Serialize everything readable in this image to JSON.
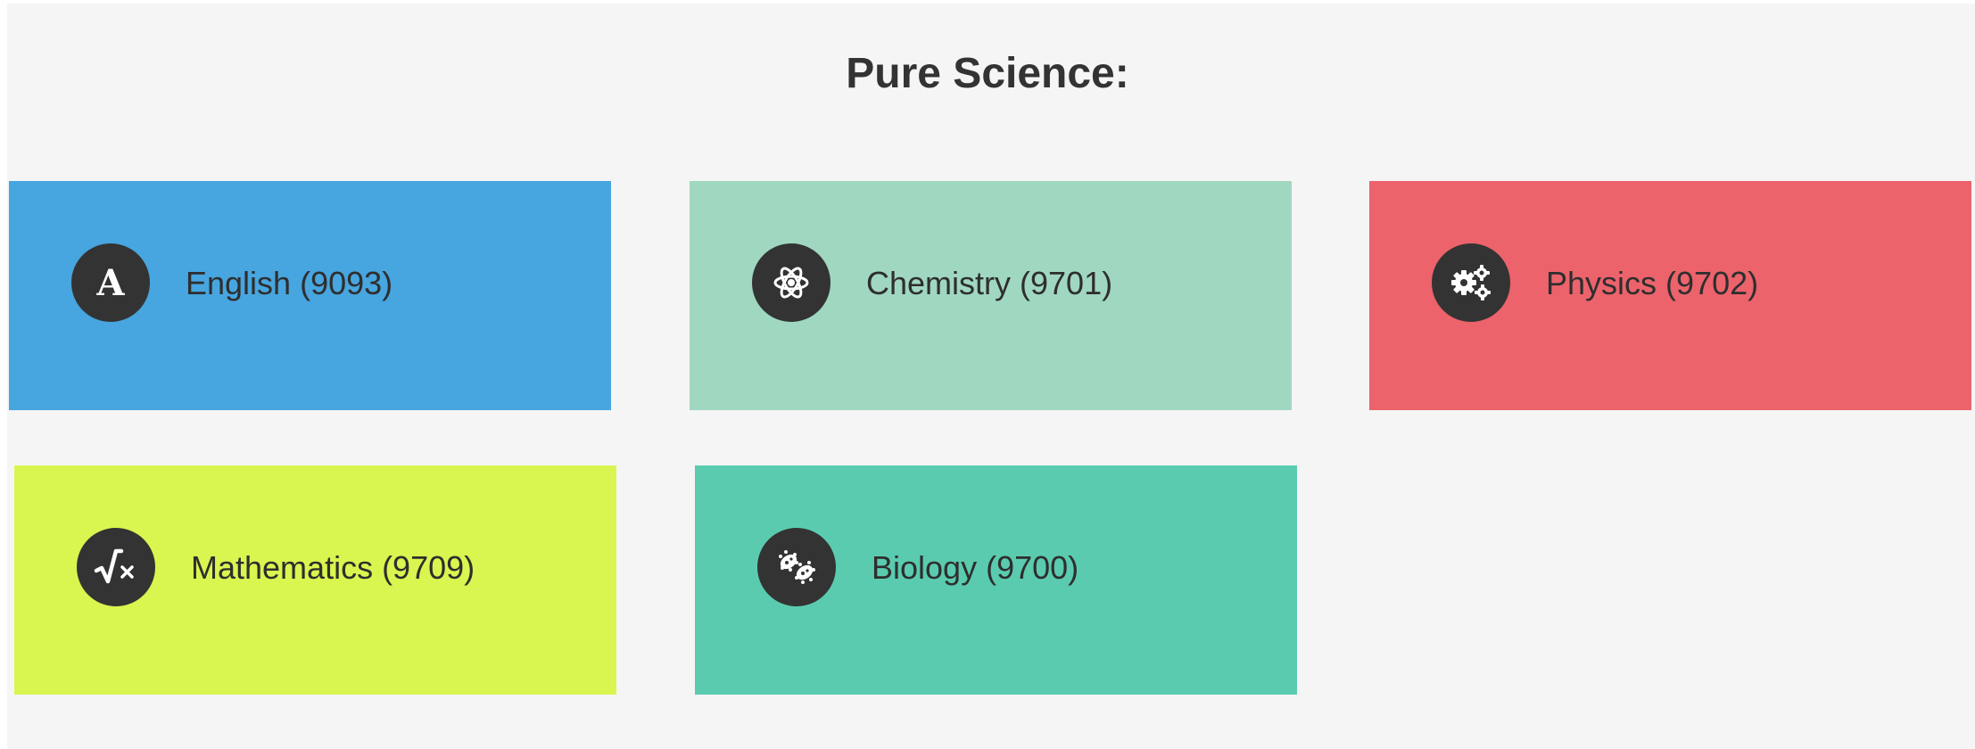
{
  "section": {
    "title": "Pure Science:"
  },
  "courses": [
    {
      "label": "English (9093)",
      "color": "#47a5df",
      "icon": "letter-a-icon"
    },
    {
      "label": "Chemistry (9701)",
      "color": "#a0d7c1",
      "icon": "atom-icon"
    },
    {
      "label": "Physics (9702)",
      "color": "#ec636c",
      "icon": "gears-icon"
    },
    {
      "label": "Mathematics (9709)",
      "color": "#d9f54f",
      "icon": "square-root-icon"
    },
    {
      "label": "Biology (9700)",
      "color": "#5acbaf",
      "icon": "bacteria-icon"
    }
  ],
  "colors": {
    "background": "#f5f5f5",
    "icon_circle": "#333333",
    "text": "#2e2e2e"
  }
}
